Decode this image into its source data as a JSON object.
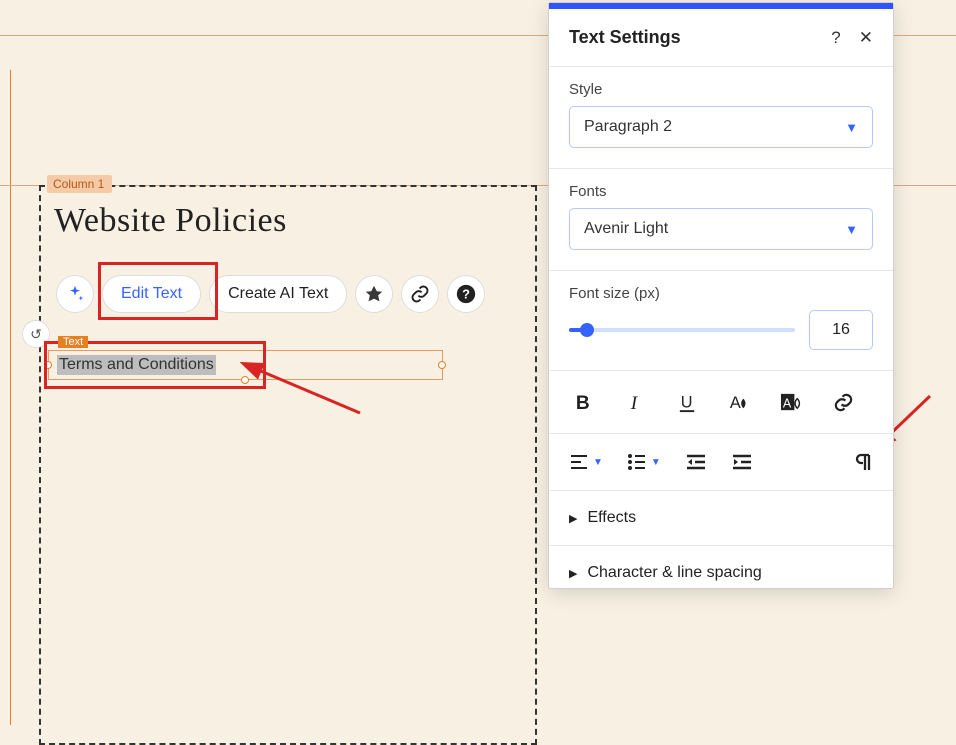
{
  "canvas": {
    "column_label": "Column 1",
    "heading": "Website Policies",
    "text_tag": "Text",
    "selected_text": "Terms and Conditions"
  },
  "actions": {
    "edit_text": "Edit Text",
    "create_ai_text": "Create AI Text"
  },
  "panel": {
    "title": "Text Settings",
    "help": "?",
    "close": "✕",
    "style_label": "Style",
    "style_value": "Paragraph 2",
    "fonts_label": "Fonts",
    "fonts_value": "Avenir Light",
    "fontsize_label": "Font size (px)",
    "fontsize_value": "16",
    "effects_label": "Effects",
    "spacing_label": "Character & line spacing"
  },
  "icons": {
    "ai": "✦",
    "animation": "❖",
    "link": "🔗",
    "help": "?",
    "undo": "↻"
  }
}
